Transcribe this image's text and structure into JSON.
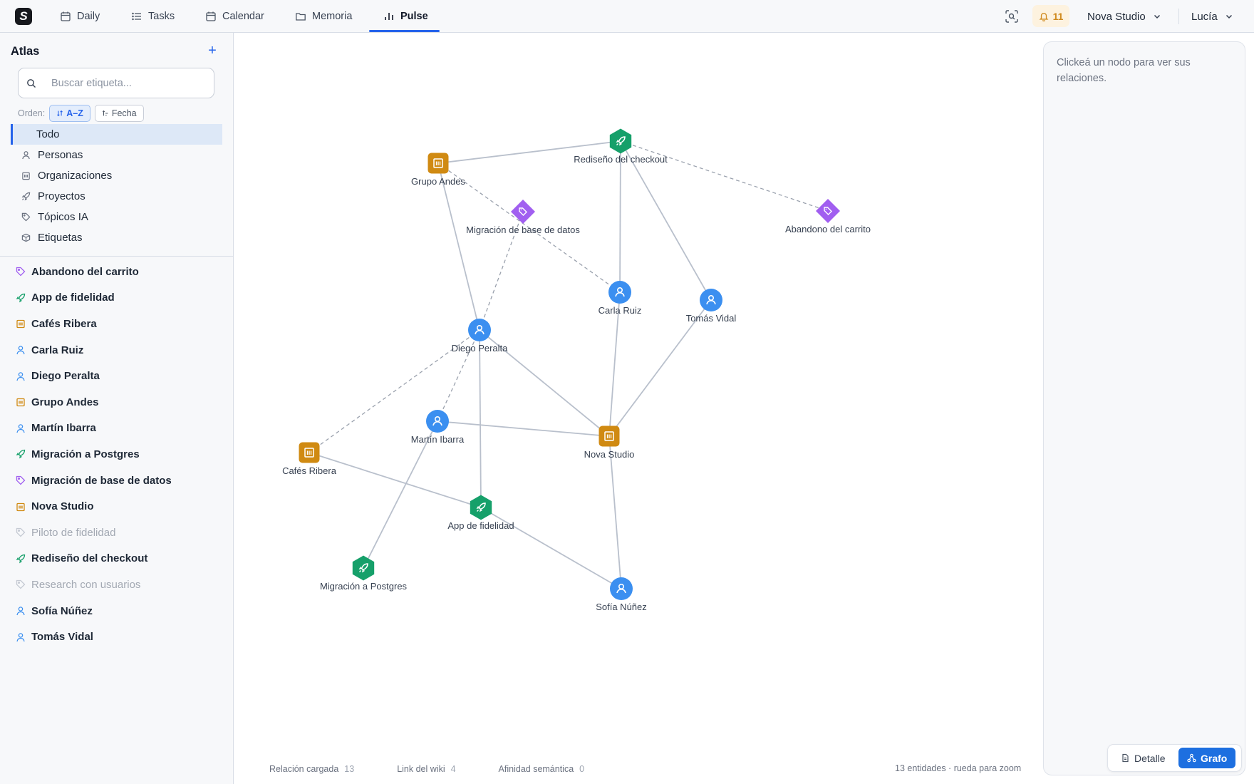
{
  "nav": {
    "logo": "S",
    "items": [
      {
        "label": "Daily",
        "icon": "calendar-icon"
      },
      {
        "label": "Tasks",
        "icon": "list-icon"
      },
      {
        "label": "Calendar",
        "icon": "calendar-icon"
      },
      {
        "label": "Memoria",
        "icon": "folder-icon"
      },
      {
        "label": "Pulse",
        "icon": "bar-chart-icon",
        "active": true
      }
    ],
    "notifications": "11",
    "workspace": "Nova Studio",
    "user": "Lucía"
  },
  "sidebar": {
    "title": "Atlas",
    "search_placeholder": "Buscar etiqueta...",
    "sort_label": "Orden:",
    "sort_az": "A–Z",
    "sort_date": "Fecha",
    "categories": [
      {
        "label": "Todo",
        "active": true
      },
      {
        "label": "Personas",
        "icon": "person-icon"
      },
      {
        "label": "Organizaciones",
        "icon": "building-icon"
      },
      {
        "label": "Proyectos",
        "icon": "rocket-icon"
      },
      {
        "label": "Tópicos IA",
        "icon": "tag-icon"
      },
      {
        "label": "Etiquetas",
        "icon": "cube-icon"
      }
    ],
    "entities": [
      {
        "label": "Abandono del carrito",
        "type": "tag"
      },
      {
        "label": "App de fidelidad",
        "type": "project"
      },
      {
        "label": "Cafés Ribera",
        "type": "org"
      },
      {
        "label": "Carla Ruiz",
        "type": "person"
      },
      {
        "label": "Diego Peralta",
        "type": "person"
      },
      {
        "label": "Grupo Andes",
        "type": "org"
      },
      {
        "label": "Martín Ibarra",
        "type": "person"
      },
      {
        "label": "Migración a Postgres",
        "type": "project"
      },
      {
        "label": "Migración de base de datos",
        "type": "tag"
      },
      {
        "label": "Nova Studio",
        "type": "org"
      },
      {
        "label": "Piloto de fidelidad",
        "type": "tag",
        "muted": true
      },
      {
        "label": "Rediseño del checkout",
        "type": "project"
      },
      {
        "label": "Research con usuarios",
        "type": "tag",
        "muted": true
      },
      {
        "label": "Sofía Núñez",
        "type": "person"
      },
      {
        "label": "Tomás Vidal",
        "type": "person"
      }
    ]
  },
  "graph": {
    "nodes": [
      {
        "id": "rediseno",
        "label": "Rediseño del checkout",
        "type": "project"
      },
      {
        "id": "grupo",
        "label": "Grupo Andes",
        "type": "org"
      },
      {
        "id": "migbd",
        "label": "Migración de base de datos",
        "type": "tag"
      },
      {
        "id": "abandono",
        "label": "Abandono del carrito",
        "type": "tag"
      },
      {
        "id": "carla",
        "label": "Carla Ruiz",
        "type": "person"
      },
      {
        "id": "tomas",
        "label": "Tomás Vidal",
        "type": "person"
      },
      {
        "id": "diego",
        "label": "Diego Peralta",
        "type": "person"
      },
      {
        "id": "martin",
        "label": "Martín Ibarra",
        "type": "person"
      },
      {
        "id": "nova",
        "label": "Nova Studio",
        "type": "org"
      },
      {
        "id": "cafes",
        "label": "Cafés Ribera",
        "type": "org"
      },
      {
        "id": "app",
        "label": "App de fidelidad",
        "type": "project"
      },
      {
        "id": "migpg",
        "label": "Migración a Postgres",
        "type": "project"
      },
      {
        "id": "sofia",
        "label": "Sofía Núñez",
        "type": "person"
      }
    ],
    "edges": [
      {
        "from": "grupo",
        "to": "rediseno",
        "kind": "loaded"
      },
      {
        "from": "rediseno",
        "to": "carla",
        "kind": "loaded"
      },
      {
        "from": "rediseno",
        "to": "tomas",
        "kind": "loaded"
      },
      {
        "from": "rediseno",
        "to": "abandono",
        "kind": "wiki"
      },
      {
        "from": "grupo",
        "to": "diego",
        "kind": "loaded"
      },
      {
        "from": "grupo",
        "to": "carla",
        "kind": "wiki"
      },
      {
        "from": "migbd",
        "to": "diego",
        "kind": "wiki"
      },
      {
        "from": "carla",
        "to": "nova",
        "kind": "loaded"
      },
      {
        "from": "tomas",
        "to": "nova",
        "kind": "loaded"
      },
      {
        "from": "diego",
        "to": "nova",
        "kind": "loaded"
      },
      {
        "from": "diego",
        "to": "app",
        "kind": "loaded"
      },
      {
        "from": "diego",
        "to": "cafes",
        "kind": "wiki"
      },
      {
        "from": "diego",
        "to": "martin",
        "kind": "wiki"
      },
      {
        "from": "martin",
        "to": "nova",
        "kind": "loaded"
      },
      {
        "from": "martin",
        "to": "migpg",
        "kind": "loaded"
      },
      {
        "from": "cafes",
        "to": "app",
        "kind": "loaded"
      },
      {
        "from": "app",
        "to": "sofia",
        "kind": "loaded"
      },
      {
        "from": "nova",
        "to": "sofia",
        "kind": "loaded"
      }
    ],
    "legend": [
      {
        "label": "Relación cargada",
        "count": "13",
        "style": "solid"
      },
      {
        "label": "Link del wiki",
        "count": "4",
        "style": "dashed"
      },
      {
        "label": "Afinidad semántica",
        "count": "0",
        "style": "dotted"
      }
    ],
    "footer": "13 entidades · rueda para zoom"
  },
  "panel": {
    "hint": "Clickeá un nodo para ver sus relaciones."
  },
  "view_toggle": {
    "detail": "Detalle",
    "graph": "Grafo"
  },
  "colors": {
    "accent": "#1d6fe0",
    "person": "#3b8ff0",
    "org": "#d08a12",
    "project": "#16a06a",
    "tag": "#a15ff0",
    "edge": "#b9c0cc"
  }
}
